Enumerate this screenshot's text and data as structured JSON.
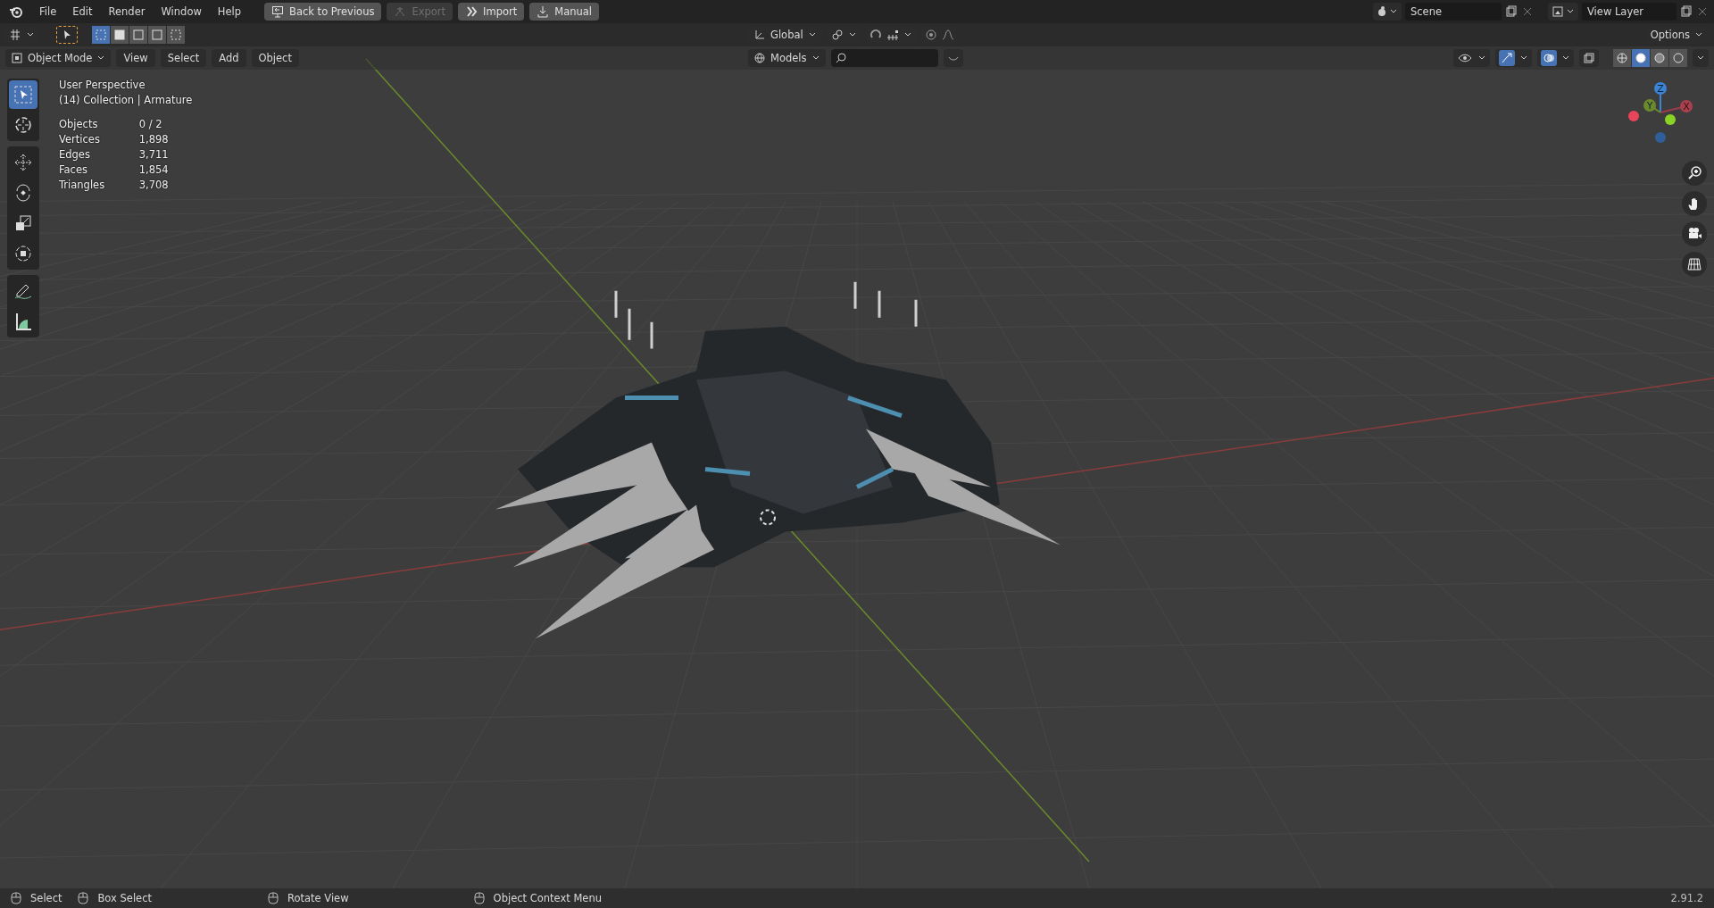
{
  "menu_bar": {
    "items": [
      "File",
      "Edit",
      "Render",
      "Window",
      "Help"
    ],
    "buttons": [
      {
        "label": "Back to Previous",
        "disabled": false
      },
      {
        "label": "Export",
        "disabled": true
      },
      {
        "label": "Import",
        "disabled": false
      },
      {
        "label": "Manual",
        "disabled": false
      }
    ],
    "scene": "Scene",
    "view_layer": "View Layer"
  },
  "tool_header": {
    "select_modes": [
      {
        "selected": true
      },
      {
        "selected": false
      },
      {
        "selected": false
      },
      {
        "selected": false
      },
      {
        "selected": false
      }
    ],
    "orientation": "Global",
    "options": "Options"
  },
  "viewport_header": {
    "mode": "Object Mode",
    "menus": [
      "View",
      "Select",
      "Add",
      "Object"
    ],
    "collection": "Models",
    "gizmos_on": true,
    "overlays_on": true,
    "shading": [
      {
        "selected": false
      },
      {
        "selected": true
      },
      {
        "selected": false
      },
      {
        "selected": false
      }
    ]
  },
  "toolbar": [
    {
      "kind": "select",
      "selected": true
    },
    {
      "kind": "cursor",
      "selected": false
    },
    {
      "kind": "move",
      "selected": false
    },
    {
      "kind": "rotate",
      "selected": false
    },
    {
      "kind": "scale",
      "selected": false
    },
    {
      "kind": "transform",
      "selected": false
    },
    {
      "kind": "annotate",
      "selected": false
    },
    {
      "kind": "measure",
      "selected": false
    }
  ],
  "overlay": {
    "title": "User Perspective",
    "context": "(14) Collection | Armature",
    "stats": [
      {
        "label": "Objects",
        "value": "0 / 2"
      },
      {
        "label": "Vertices",
        "value": "1,898"
      },
      {
        "label": "Edges",
        "value": "3,711"
      },
      {
        "label": "Faces",
        "value": "1,854"
      },
      {
        "label": "Triangles",
        "value": "3,708"
      }
    ]
  },
  "gizmo": {
    "z": "Z",
    "y": "Y",
    "x": "X"
  },
  "status_bar": {
    "hints": [
      "Select",
      "Box Select",
      "Rotate View",
      "Object Context Menu"
    ],
    "version": "2.91.2"
  }
}
